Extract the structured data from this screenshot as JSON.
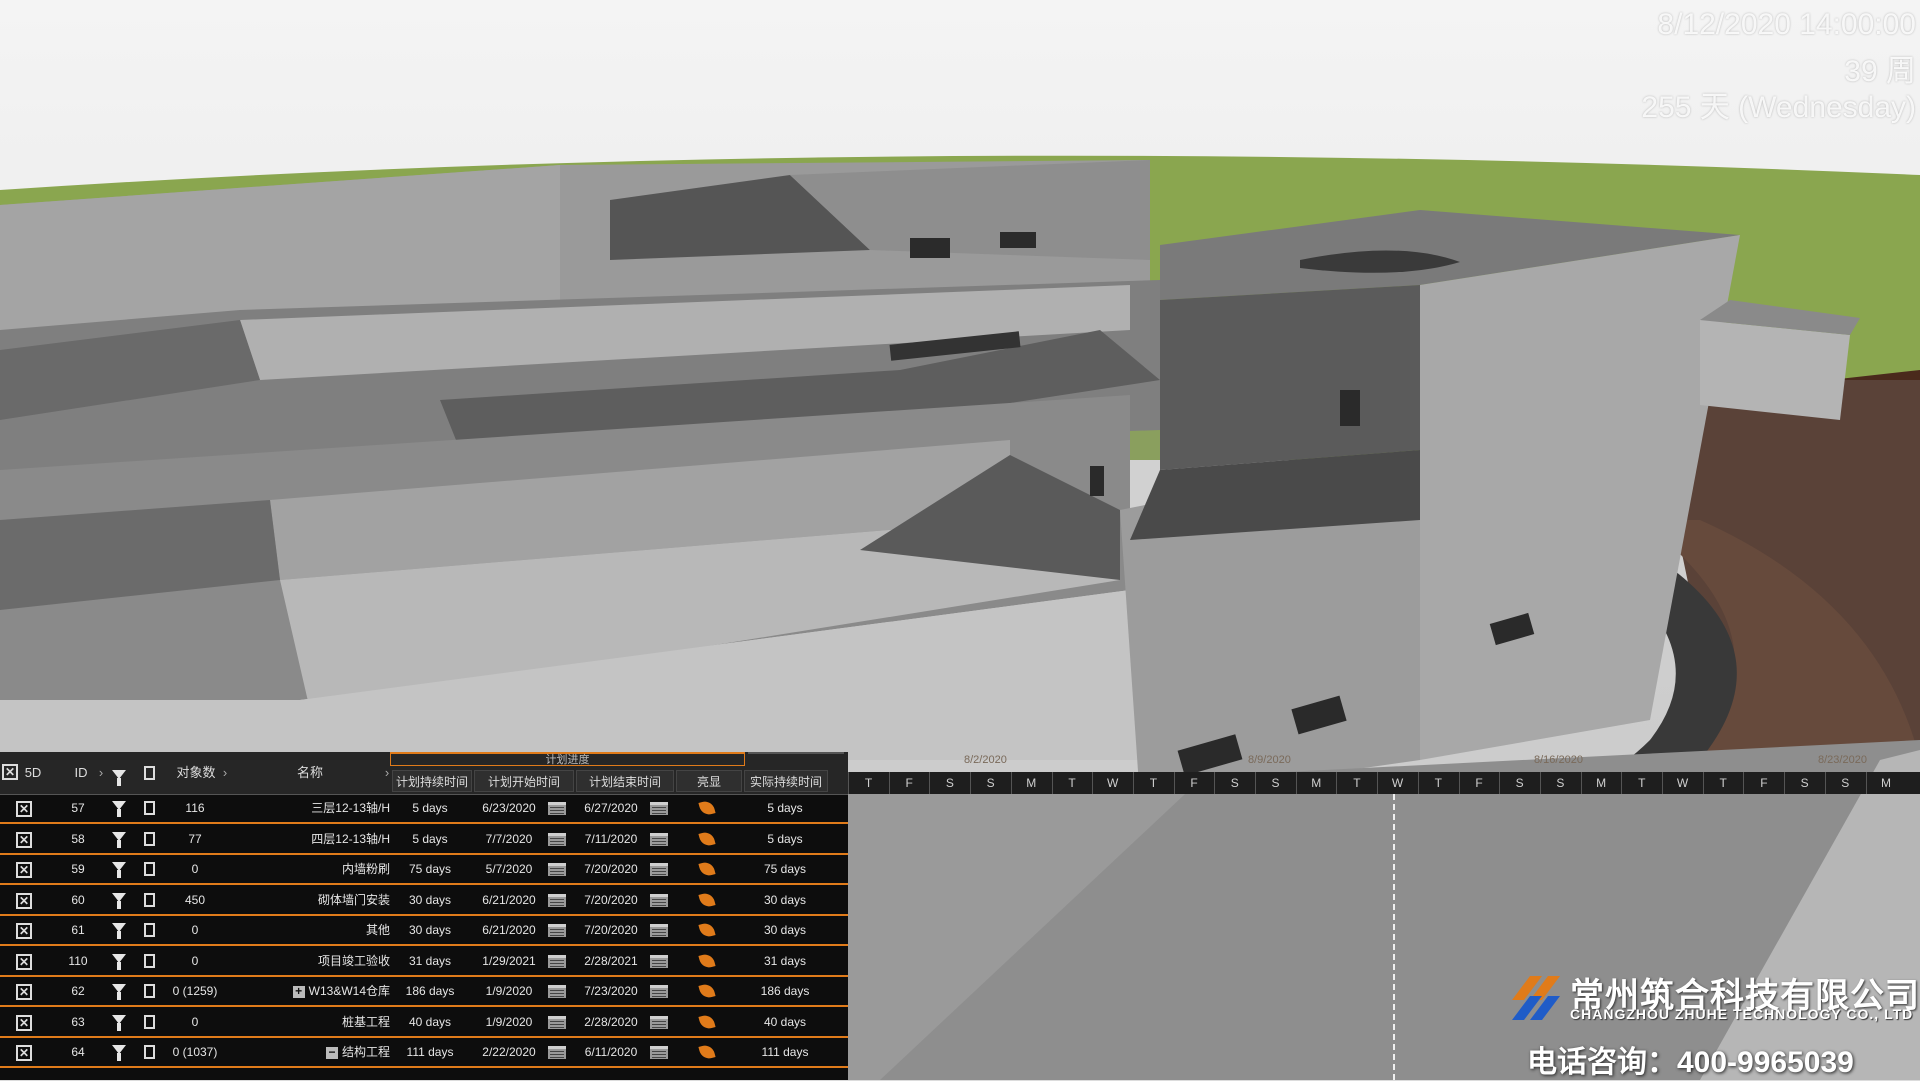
{
  "overlay": {
    "datetime": "8/12/2020 14:00:00",
    "week": "39 周",
    "day": "255 天 (Wednesday)"
  },
  "table": {
    "headers": {
      "mode": "5D",
      "id": "ID",
      "object_count": "对象数",
      "name": "名称",
      "plan_group": "计划进度",
      "plan_duration": "计划持续时间",
      "plan_start": "计划开始时间",
      "plan_end": "计划结束时间",
      "highlight": "亮显",
      "actual_duration": "实际持续时间"
    },
    "rows": [
      {
        "id": "57",
        "count": "116",
        "name": "三层12-13轴/H",
        "duration": "5 days",
        "start": "6/23/2020",
        "end": "6/27/2020",
        "actual": "5 days"
      },
      {
        "id": "58",
        "count": "77",
        "name": "四层12-13轴/H",
        "duration": "5 days",
        "start": "7/7/2020",
        "end": "7/11/2020",
        "actual": "5 days"
      },
      {
        "id": "59",
        "count": "0",
        "name": "内墙粉刷",
        "duration": "75 days",
        "start": "5/7/2020",
        "end": "7/20/2020",
        "actual": "75 days"
      },
      {
        "id": "60",
        "count": "450",
        "name": "砌体墙门安装",
        "duration": "30 days",
        "start": "6/21/2020",
        "end": "7/20/2020",
        "actual": "30 days"
      },
      {
        "id": "61",
        "count": "0",
        "name": "其他",
        "duration": "30 days",
        "start": "6/21/2020",
        "end": "7/20/2020",
        "actual": "30 days"
      },
      {
        "id": "110",
        "count": "0",
        "name": "项目竣工验收",
        "duration": "31 days",
        "start": "1/29/2021",
        "end": "2/28/2021",
        "actual": "31 days"
      },
      {
        "id": "62",
        "count": "0 (1259)",
        "name": "W13&W14仓库",
        "duration": "186 days",
        "start": "1/9/2020",
        "end": "7/23/2020",
        "actual": "186 days"
      },
      {
        "id": "63",
        "count": "0",
        "name": "桩基工程",
        "duration": "40 days",
        "start": "1/9/2020",
        "end": "2/28/2020",
        "actual": "40 days"
      },
      {
        "id": "64",
        "count": "0 (1037)",
        "name": "结构工程",
        "duration": "111 days",
        "start": "2/22/2020",
        "end": "6/11/2020",
        "actual": "111 days"
      }
    ]
  },
  "timeline": {
    "dates": [
      "8/2/2020",
      "8/9/2020",
      "8/16/2020",
      "8/23/2020"
    ],
    "days": [
      "T",
      "F",
      "S",
      "S",
      "M",
      "T",
      "W",
      "T",
      "F",
      "S",
      "S",
      "M",
      "T",
      "W",
      "T",
      "F",
      "S",
      "S",
      "M",
      "T",
      "W",
      "T",
      "F",
      "S",
      "S",
      "M"
    ]
  },
  "brand": {
    "name_cn": "常州筑合科技有限公司",
    "name_en": "CHANGZHOU ZHUHE TECHNOLOGY CO., LTD",
    "hotline": "电话咨询：400-9965039"
  },
  "colors": {
    "accent": "#e07b1a",
    "panel_bg": "#0d0d0d",
    "grass": "#8aa64f",
    "dirt": "#4a2a1c"
  }
}
